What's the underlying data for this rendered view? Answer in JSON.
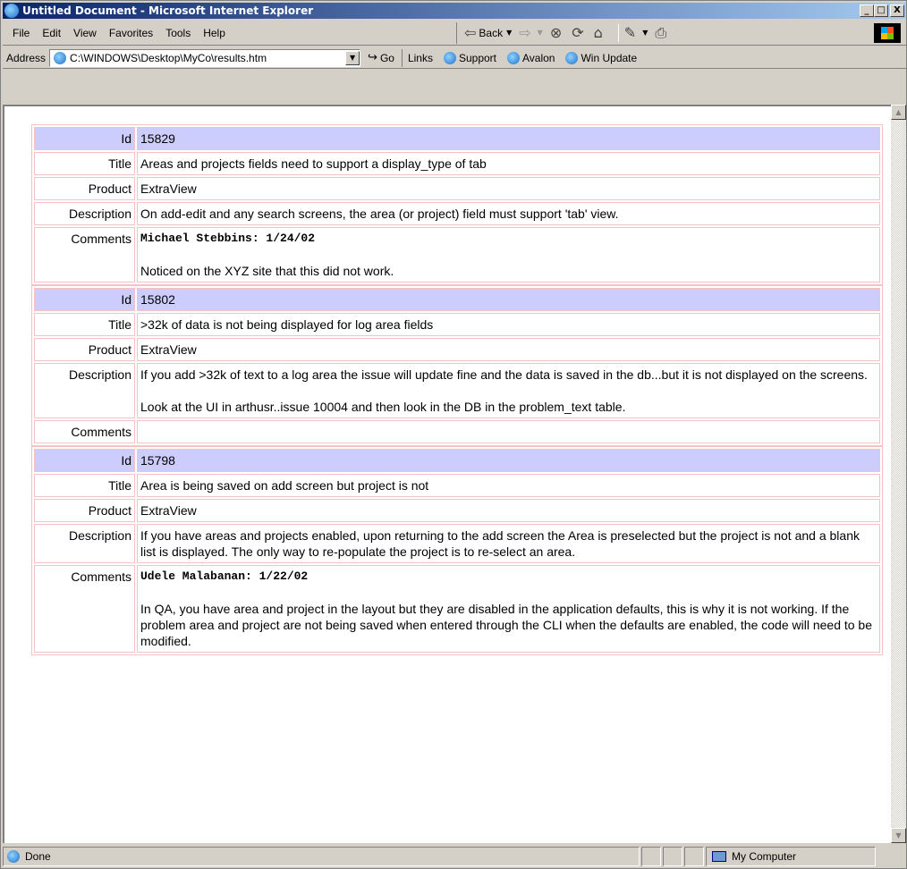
{
  "window": {
    "title": "Untitled Document - Microsoft Internet Explorer",
    "minimize": "_",
    "maximize": "□",
    "close": "X"
  },
  "menu": [
    "File",
    "Edit",
    "View",
    "Favorites",
    "Tools",
    "Help"
  ],
  "toolbar": {
    "back_label": "Back",
    "back_icon": "back-arrow-icon",
    "forward_icon": "forward-arrow-icon",
    "stop_icon": "stop-icon",
    "refresh_icon": "refresh-icon",
    "home_icon": "home-icon",
    "edit_icon": "edit-icon",
    "print_icon": "print-icon"
  },
  "address": {
    "label": "Address",
    "value": "C:\\WINDOWS\\Desktop\\MyCo\\results.htm",
    "go_label": "Go",
    "links_label": "Links",
    "links": [
      "Support",
      "Avalon",
      "Win Update"
    ]
  },
  "labels": {
    "id": "Id",
    "title": "Title",
    "product": "Product",
    "description": "Description",
    "comments": "Comments"
  },
  "issues": [
    {
      "id": "15829",
      "title": "Areas and projects fields need to support a display_type of tab",
      "product": "ExtraView",
      "description": "On add-edit and any search screens, the area (or project) field must support 'tab' view.",
      "description_2": "",
      "comment_author": "Michael Stebbins: 1/24/02",
      "comment_text": "Noticed on the XYZ site that this did not work."
    },
    {
      "id": "15802",
      "title": ">32k of data is not being displayed for log area fields",
      "product": "ExtraView",
      "description": "If you add >32k of text to a log area the issue will update fine and the data is saved in the db...but it is not displayed on the screens.",
      "description_2": "Look at the UI in arthusr..issue 10004 and then look in the DB in the problem_text table.",
      "comment_author": "",
      "comment_text": ""
    },
    {
      "id": "15798",
      "title": "Area is being saved on add screen but project is not",
      "product": "ExtraView",
      "description": "If you have areas and projects enabled, upon returning to the add screen the Area is preselected but the project is not and a blank list is displayed. The only way to re-populate the project is to re-select an area.",
      "description_2": "",
      "comment_author": "Udele Malabanan: 1/22/02",
      "comment_text": "In QA, you have area and project in the layout but they are disabled in the application defaults, this is why it is not working. If the problem area and project are not being saved when entered through the CLI when the defaults are enabled, the code will need to be modified."
    }
  ],
  "status": {
    "text": "Done",
    "zone": "My Computer"
  },
  "colors": {
    "id_row_bg": "#cccdfc",
    "cell_border": "#f4c4c4",
    "titlebar": "#0a246a"
  }
}
